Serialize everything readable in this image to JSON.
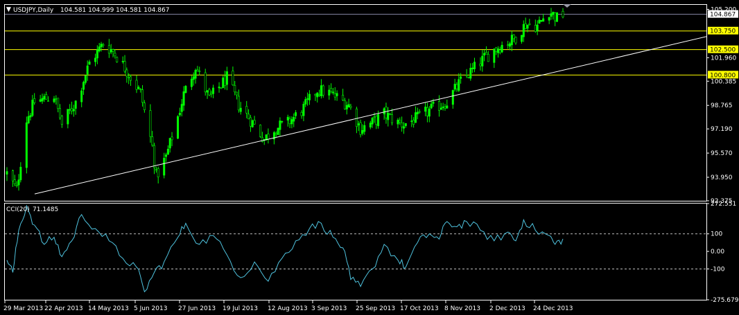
{
  "symbol_header": {
    "menu_glyph": "▼",
    "symbol": "USDJPY,Daily",
    "ohlc": "104.581 104.999 104.581 104.867"
  },
  "indicator_header": {
    "label": "CCI(20)",
    "value": "71.1485"
  },
  "colors": {
    "background": "#000000",
    "frame": "#ffffff",
    "bull_candle": "#00ff00",
    "bear_candle": "#000000",
    "candle_wick": "#00ff00",
    "trendline": "#ffffff",
    "level_line": "#ffff00",
    "level_label_bg": "#ffff00",
    "current_price_label_bg": "#ffffff",
    "current_price_line": "#8a8aa8",
    "cci_line": "#4fc3df",
    "cci_level_line": "#c0c0c0"
  },
  "chart_data": [
    {
      "type": "candlestick",
      "title": "USDJPY,Daily",
      "price_axis_ticks": [
        "105.200",
        "101.960",
        "100.385",
        "98.765",
        "97.190",
        "95.570",
        "93.950",
        "92.375"
      ],
      "current_price_label": "104.867",
      "horizontal_levels": [
        {
          "value": 103.75,
          "label": "103.750"
        },
        {
          "value": 102.5,
          "label": "102.500"
        },
        {
          "value": 100.8,
          "label": "100.800"
        }
      ],
      "ylim": [
        92.375,
        105.5
      ],
      "x_tick_labels": [
        "29 Mar 2013",
        "22 Apr 2013",
        "14 May 2013",
        "5 Jun 2013",
        "27 Jun 2013",
        "19 Jul 2013",
        "12 Aug 2013",
        "3 Sep 2013",
        "25 Sep 2013",
        "17 Oct 2013",
        "8 Nov 2013",
        "2 Dec 2013",
        "24 Dec 2013"
      ],
      "trendline": {
        "from": {
          "date": "2013-03-29",
          "price": 92.4
        },
        "to": {
          "date": "2014-01-02",
          "price": 101.0
        }
      },
      "close_path": [
        {
          "date": "2013-03-29",
          "close": 94.2
        },
        {
          "date": "2013-04-03",
          "close": 93.1
        },
        {
          "date": "2013-04-08",
          "close": 97.8
        },
        {
          "date": "2013-04-12",
          "close": 99.0
        },
        {
          "date": "2013-04-22",
          "close": 99.4
        },
        {
          "date": "2013-04-26",
          "close": 97.5
        },
        {
          "date": "2013-05-03",
          "close": 99.0
        },
        {
          "date": "2013-05-10",
          "close": 101.6
        },
        {
          "date": "2013-05-17",
          "close": 102.9
        },
        {
          "date": "2013-05-22",
          "close": 102.4
        },
        {
          "date": "2013-05-28",
          "close": 101.3
        },
        {
          "date": "2013-06-05",
          "close": 99.6
        },
        {
          "date": "2013-06-11",
          "close": 96.0
        },
        {
          "date": "2013-06-13",
          "close": 94.0
        },
        {
          "date": "2013-06-18",
          "close": 95.3
        },
        {
          "date": "2013-06-24",
          "close": 98.0
        },
        {
          "date": "2013-06-27",
          "close": 99.5
        },
        {
          "date": "2013-07-03",
          "close": 101.4
        },
        {
          "date": "2013-07-10",
          "close": 99.2
        },
        {
          "date": "2013-07-19",
          "close": 100.6
        },
        {
          "date": "2013-07-25",
          "close": 98.8
        },
        {
          "date": "2013-07-31",
          "close": 97.8
        },
        {
          "date": "2013-08-07",
          "close": 96.5
        },
        {
          "date": "2013-08-12",
          "close": 97.2
        },
        {
          "date": "2013-08-19",
          "close": 97.6
        },
        {
          "date": "2013-08-26",
          "close": 98.4
        },
        {
          "date": "2013-09-03",
          "close": 99.8
        },
        {
          "date": "2013-09-09",
          "close": 99.6
        },
        {
          "date": "2013-09-13",
          "close": 99.3
        },
        {
          "date": "2013-09-19",
          "close": 98.8
        },
        {
          "date": "2013-09-25",
          "close": 97.2
        },
        {
          "date": "2013-10-01",
          "close": 97.6
        },
        {
          "date": "2013-10-07",
          "close": 98.2
        },
        {
          "date": "2013-10-14",
          "close": 97.6
        },
        {
          "date": "2013-10-17",
          "close": 97.5
        },
        {
          "date": "2013-10-24",
          "close": 97.9
        },
        {
          "date": "2013-10-31",
          "close": 98.5
        },
        {
          "date": "2013-11-08",
          "close": 99.0
        },
        {
          "date": "2013-11-14",
          "close": 100.2
        },
        {
          "date": "2013-11-20",
          "close": 101.0
        },
        {
          "date": "2013-11-26",
          "close": 101.8
        },
        {
          "date": "2013-12-02",
          "close": 102.5
        },
        {
          "date": "2013-12-06",
          "close": 102.8
        },
        {
          "date": "2013-12-12",
          "close": 103.2
        },
        {
          "date": "2013-12-18",
          "close": 104.2
        },
        {
          "date": "2013-12-24",
          "close": 104.1
        },
        {
          "date": "2013-12-30",
          "close": 105.1
        },
        {
          "date": "2014-01-03",
          "close": 104.6
        },
        {
          "date": "2014-01-06",
          "close": 104.867
        }
      ]
    },
    {
      "type": "line",
      "title": "CCI(20) 71.1485",
      "axis_ticks": [
        "272.551",
        "100",
        "0.00",
        "-100",
        "-275.6793"
      ],
      "ylim": [
        -275.6793,
        272.551
      ],
      "levels": [
        100,
        0,
        -100
      ],
      "series": [
        {
          "name": "CCI(20)",
          "points": [
            {
              "date": "2013-03-29",
              "cci": -50
            },
            {
              "date": "2013-04-01",
              "cci": -120
            },
            {
              "date": "2013-04-04",
              "cci": 120
            },
            {
              "date": "2013-04-08",
              "cci": 260
            },
            {
              "date": "2013-04-12",
              "cci": 150
            },
            {
              "date": "2013-04-17",
              "cci": 40
            },
            {
              "date": "2013-04-22",
              "cci": 80
            },
            {
              "date": "2013-04-26",
              "cci": -30
            },
            {
              "date": "2013-05-01",
              "cci": 60
            },
            {
              "date": "2013-05-06",
              "cci": 210
            },
            {
              "date": "2013-05-13",
              "cci": 130
            },
            {
              "date": "2013-05-20",
              "cci": 60
            },
            {
              "date": "2013-05-27",
              "cci": -40
            },
            {
              "date": "2013-06-03",
              "cci": -90
            },
            {
              "date": "2013-06-07",
              "cci": -230
            },
            {
              "date": "2013-06-12",
              "cci": -120
            },
            {
              "date": "2013-06-17",
              "cci": -60
            },
            {
              "date": "2013-06-24",
              "cci": 80
            },
            {
              "date": "2013-06-28",
              "cci": 160
            },
            {
              "date": "2013-07-05",
              "cci": 40
            },
            {
              "date": "2013-07-12",
              "cci": 90
            },
            {
              "date": "2013-07-19",
              "cci": -20
            },
            {
              "date": "2013-07-26",
              "cci": -150
            },
            {
              "date": "2013-08-02",
              "cci": -60
            },
            {
              "date": "2013-08-09",
              "cci": -170
            },
            {
              "date": "2013-08-16",
              "cci": -40
            },
            {
              "date": "2013-08-23",
              "cci": 60
            },
            {
              "date": "2013-08-30",
              "cci": 130
            },
            {
              "date": "2013-09-05",
              "cci": 160
            },
            {
              "date": "2013-09-11",
              "cci": 80
            },
            {
              "date": "2013-09-16",
              "cci": 20
            },
            {
              "date": "2013-09-20",
              "cci": -160
            },
            {
              "date": "2013-09-25",
              "cci": -200
            },
            {
              "date": "2013-10-01",
              "cci": -100
            },
            {
              "date": "2013-10-07",
              "cci": 40
            },
            {
              "date": "2013-10-14",
              "cci": -50
            },
            {
              "date": "2013-10-18",
              "cci": -90
            },
            {
              "date": "2013-10-24",
              "cci": 50
            },
            {
              "date": "2013-10-30",
              "cci": 100
            },
            {
              "date": "2013-11-04",
              "cci": 70
            },
            {
              "date": "2013-11-08",
              "cci": 170
            },
            {
              "date": "2013-11-13",
              "cci": 140
            },
            {
              "date": "2013-11-18",
              "cci": 170
            },
            {
              "date": "2013-11-25",
              "cci": 120
            },
            {
              "date": "2013-12-02",
              "cci": 60
            },
            {
              "date": "2013-12-09",
              "cci": 110
            },
            {
              "date": "2013-12-13",
              "cci": 60
            },
            {
              "date": "2013-12-17",
              "cci": 180
            },
            {
              "date": "2013-12-23",
              "cci": 120
            },
            {
              "date": "2013-12-30",
              "cci": 90
            },
            {
              "date": "2014-01-02",
              "cci": 40
            },
            {
              "date": "2014-01-06",
              "cci": 71.1485
            }
          ]
        }
      ]
    }
  ]
}
